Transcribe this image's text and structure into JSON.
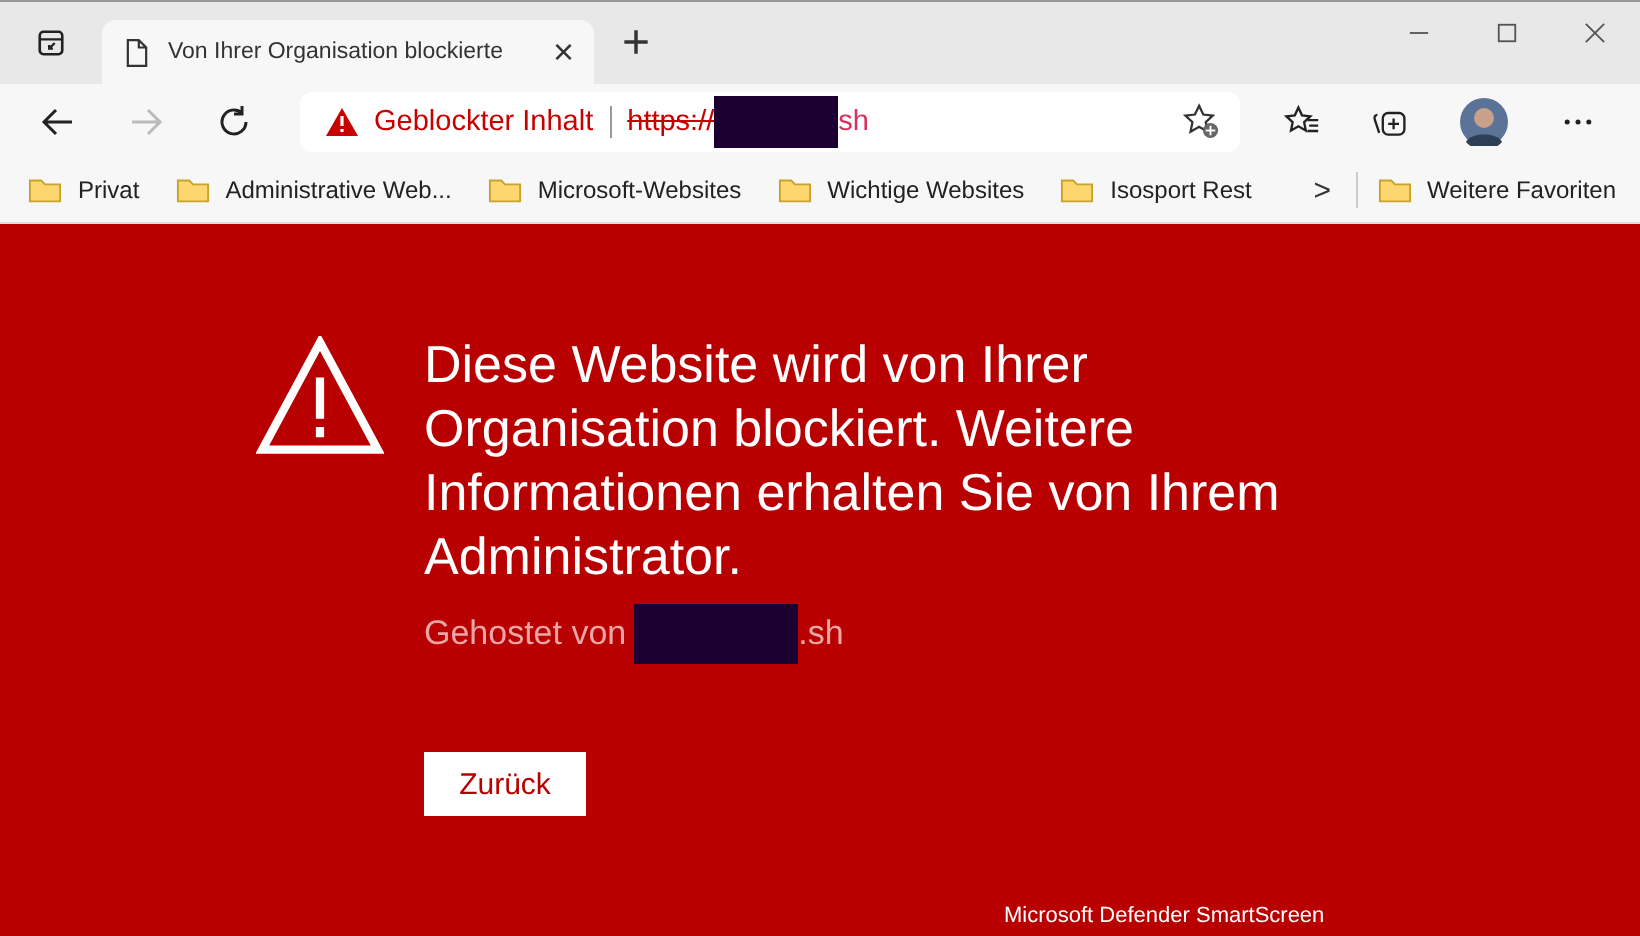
{
  "tab": {
    "title": "Von Ihrer Organisation blockierte",
    "close": "×",
    "new_tab": "+"
  },
  "address_bar": {
    "status": "Geblockter Inhalt",
    "url_scheme": "https://",
    "url_end": "sh",
    "redacted": true
  },
  "bookmarks": [
    {
      "label": "Privat"
    },
    {
      "label": "Administrative Web..."
    },
    {
      "label": "Microsoft-Websites"
    },
    {
      "label": "Wichtige Websites"
    },
    {
      "label": "Isosport Rest"
    }
  ],
  "more_bookmarks": {
    "chevron": ">",
    "label": "Weitere Favoriten"
  },
  "page": {
    "heading": "Diese Website wird von Ihrer Organisation blockiert. Weitere Informationen erhalten Sie von Ihrem Administrator.",
    "hosted_prefix": "Gehostet von",
    "hosted_suffix": ".sh",
    "back_button": "Zurück",
    "footer": "Microsoft Defender SmartScreen"
  }
}
